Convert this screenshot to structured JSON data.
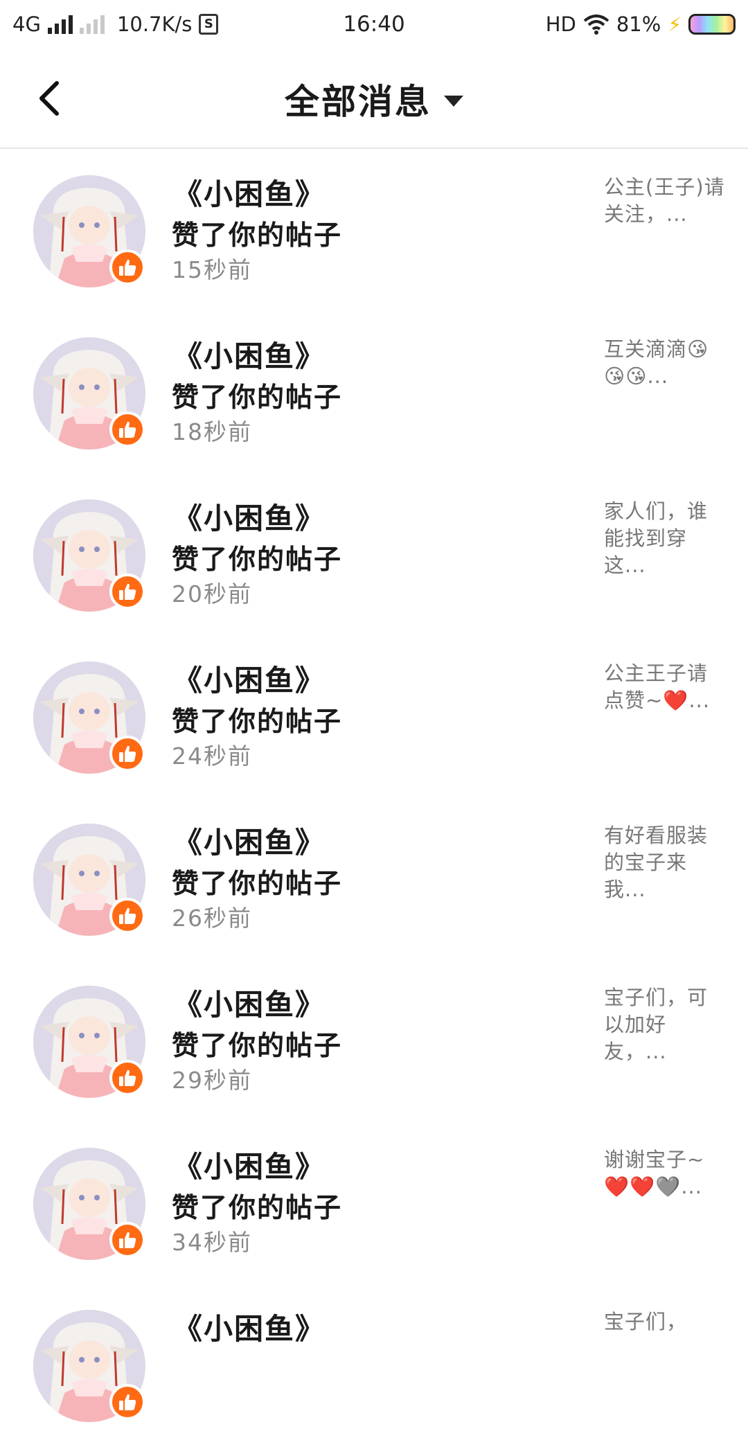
{
  "status_bar": {
    "network": "4G",
    "speed": "10.7K/s",
    "sim_icon": "S",
    "time": "16:40",
    "hd": "HD",
    "battery": "81%"
  },
  "header": {
    "title": "全部消息",
    "back_icon": "chevron-left-icon",
    "dropdown_icon": "caret-down-icon"
  },
  "messages": [
    {
      "name": "《小困鱼》",
      "action": "赞了你的帖子",
      "time": "15秒前",
      "preview": "公主(王子)请关注，..."
    },
    {
      "name": "《小困鱼》",
      "action": "赞了你的帖子",
      "time": "18秒前",
      "preview": "互关滴滴😘😘😘..."
    },
    {
      "name": "《小困鱼》",
      "action": "赞了你的帖子",
      "time": "20秒前",
      "preview": "家人们，谁能找到穿这..."
    },
    {
      "name": "《小困鱼》",
      "action": "赞了你的帖子",
      "time": "24秒前",
      "preview": "公主王子请点赞~❤️..."
    },
    {
      "name": "《小困鱼》",
      "action": "赞了你的帖子",
      "time": "26秒前",
      "preview": "有好看服装的宝子来我..."
    },
    {
      "name": "《小困鱼》",
      "action": "赞了你的帖子",
      "time": "29秒前",
      "preview": "宝子们，可以加好友，..."
    },
    {
      "name": "《小困鱼》",
      "action": "赞了你的帖子",
      "time": "34秒前",
      "preview": "谢谢宝子~❤️❤️🩶..."
    },
    {
      "name": "《小困鱼》",
      "action": "",
      "time": "",
      "preview": "宝子们，"
    }
  ],
  "colors": {
    "like_badge": "#ff6a13",
    "avatar_bg": "#ddd9e8",
    "time_text": "#8a8a8a"
  }
}
